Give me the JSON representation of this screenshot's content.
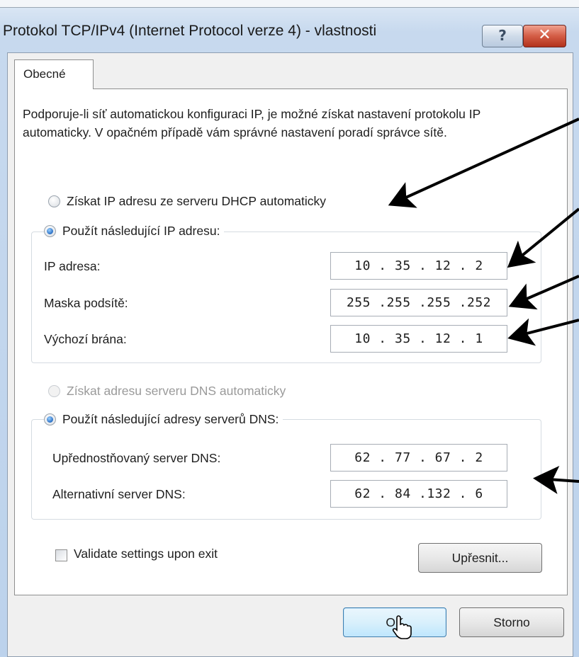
{
  "window": {
    "title": "Protokol TCP/IPv4 (Internet Protocol verze 4) - vlastnosti",
    "help_label": "?",
    "close_label": "✕"
  },
  "tabs": [
    {
      "label": "Obecné",
      "active": true
    }
  ],
  "description": "Podporuje-li síť automatickou konfiguraci IP, je možné získat nastavení protokolu IP automaticky. V opačném případě vám správné nastavení poradí správce sítě.",
  "ip_section": {
    "auto_option": {
      "label": "Získat IP adresu ze serveru DHCP automaticky",
      "checked": false
    },
    "manual_option": {
      "label": "Použít následující IP adresu:",
      "checked": true
    },
    "fields": [
      {
        "label": "IP adresa:",
        "value": "10 . 35 . 12 . 2"
      },
      {
        "label": "Maska podsítě:",
        "value": "255 .255 .255 .252"
      },
      {
        "label": "Výchozí brána:",
        "value": "10 . 35 . 12 . 1"
      }
    ]
  },
  "dns_section": {
    "auto_option": {
      "label": "Získat adresu serveru DNS automaticky",
      "checked": false,
      "disabled": true
    },
    "manual_option": {
      "label": "Použít následující adresy serverů DNS:",
      "checked": true
    },
    "fields": [
      {
        "label": "Upřednostňovaný server DNS:",
        "value": "62 . 77 . 67 . 2"
      },
      {
        "label": "Alternativní server DNS:",
        "value": "62 . 84 .132 . 6"
      }
    ]
  },
  "validate_checkbox": {
    "label": "Validate settings upon exit",
    "checked": false
  },
  "buttons": {
    "advanced": "Upřesnit...",
    "ok": "OK",
    "cancel": "Storno"
  },
  "colors": {
    "radio_checked": "#2a6fc4",
    "close_button": "#c8452e",
    "annotation_arrows": "#000000"
  }
}
